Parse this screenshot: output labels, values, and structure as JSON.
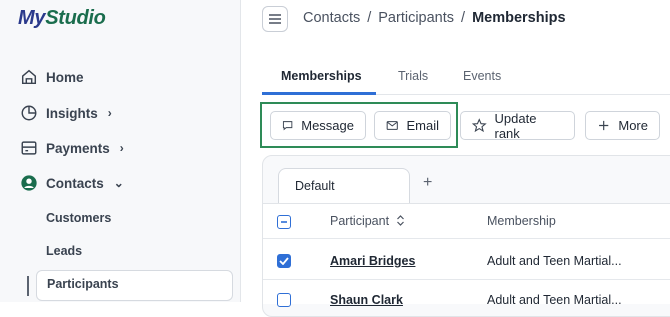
{
  "app": {
    "logo_part1": "My",
    "logo_part2": "Studio"
  },
  "sidebar": {
    "items": [
      {
        "label": "Home",
        "icon": "home-icon"
      },
      {
        "label": "Insights",
        "icon": "pie-chart-icon",
        "chevron": "›"
      },
      {
        "label": "Payments",
        "icon": "payments-icon",
        "chevron": "›"
      },
      {
        "label": "Contacts",
        "icon": "user-circle-icon",
        "chevron": "⌄"
      }
    ],
    "sub_items": [
      "Customers",
      "Leads",
      "Participants"
    ]
  },
  "header": {
    "breadcrumb": [
      "Contacts",
      "Participants",
      "Memberships"
    ],
    "separator": "/"
  },
  "tabs": [
    "Memberships",
    "Trials",
    "Events"
  ],
  "toolbar": {
    "message": "Message",
    "email": "Email",
    "update_rank": "Update rank",
    "more": "More"
  },
  "table": {
    "view_tab": "Default",
    "add_view": "+",
    "columns": [
      "Participant",
      "Membership"
    ],
    "rows": [
      {
        "participant": "Amari Bridges",
        "membership": "Adult and Teen Martial...",
        "checked": true
      },
      {
        "participant": "Shaun Clark",
        "membership": "Adult and Teen Martial...",
        "checked": false
      }
    ]
  },
  "colors": {
    "accent": "#2f6fd6",
    "highlight": "#2e8b57",
    "brand": "#2b3a8c"
  }
}
